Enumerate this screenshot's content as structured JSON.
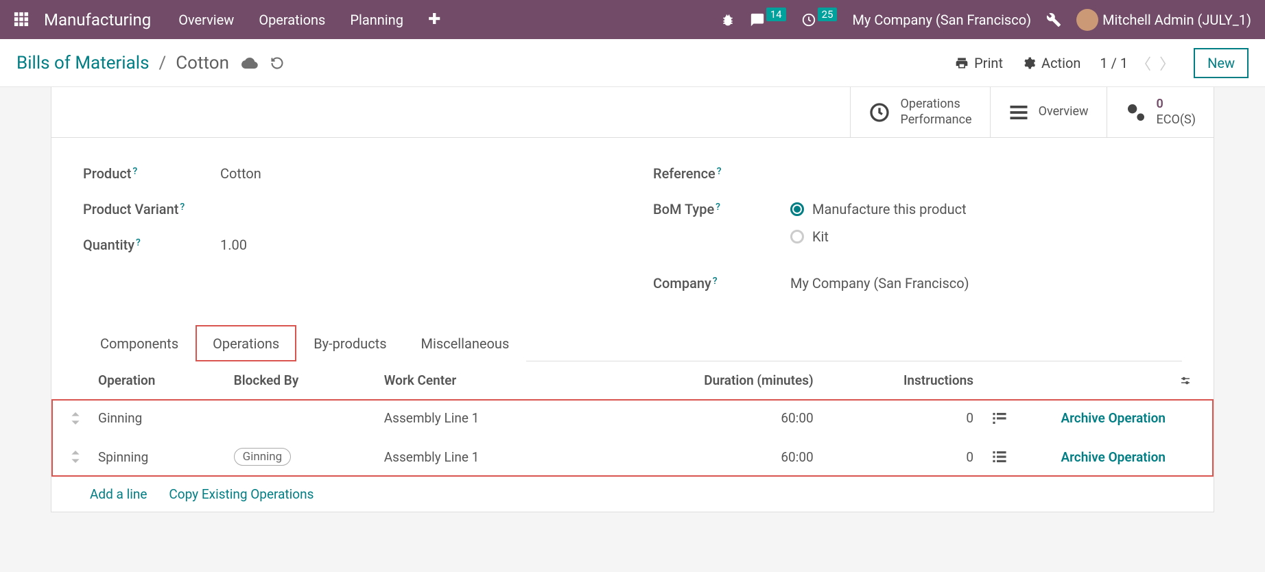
{
  "topnav": {
    "brand": "Manufacturing",
    "items": [
      "Overview",
      "Operations",
      "Planning"
    ],
    "messages_count": "14",
    "activities_count": "25",
    "company": "My Company (San Francisco)",
    "user": "Mitchell Admin (JULY_1)"
  },
  "ctrlbar": {
    "crumb_root": "Bills of Materials",
    "crumb_active": "Cotton",
    "print": "Print",
    "action": "Action",
    "pager": "1 / 1",
    "new": "New"
  },
  "stats": {
    "ops_perf": "Operations\nPerformance",
    "overview": "Overview",
    "ecos_count": "0",
    "ecos_label": "ECO(S)"
  },
  "form": {
    "labels": {
      "product": "Product",
      "product_variant": "Product Variant",
      "quantity": "Quantity",
      "reference": "Reference",
      "bom_type": "BoM Type",
      "company": "Company"
    },
    "values": {
      "product": "Cotton",
      "quantity": "1.00",
      "company": "My Company (San Francisco)",
      "bom_type_manufacture": "Manufacture this product",
      "bom_type_kit": "Kit"
    }
  },
  "tabs": [
    "Components",
    "Operations",
    "By-products",
    "Miscellaneous"
  ],
  "table": {
    "headers": {
      "operation": "Operation",
      "blocked_by": "Blocked By",
      "work_center": "Work Center",
      "duration": "Duration (minutes)",
      "instructions": "Instructions"
    },
    "rows": [
      {
        "operation": "Ginning",
        "blocked_by": "",
        "work_center": "Assembly Line 1",
        "duration": "60:00",
        "instructions": "0",
        "archive": "Archive Operation"
      },
      {
        "operation": "Spinning",
        "blocked_by": "Ginning",
        "work_center": "Assembly Line 1",
        "duration": "60:00",
        "instructions": "0",
        "archive": "Archive Operation"
      }
    ],
    "add_line": "Add a line",
    "copy_existing": "Copy Existing Operations"
  }
}
